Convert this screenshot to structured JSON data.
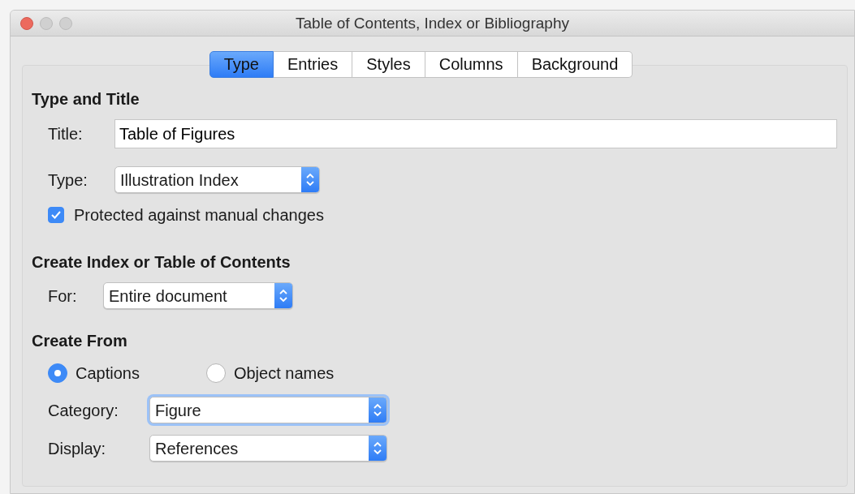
{
  "window": {
    "title": "Table of Contents, Index or Bibliography"
  },
  "tabs": [
    {
      "label": "Type",
      "selected": true
    },
    {
      "label": "Entries",
      "selected": false
    },
    {
      "label": "Styles",
      "selected": false
    },
    {
      "label": "Columns",
      "selected": false
    },
    {
      "label": "Background",
      "selected": false
    }
  ],
  "sections": [
    {
      "heading": "Type and Title",
      "rows": [
        {
          "kind": "text",
          "label": "Title:",
          "value": "Table of Figures"
        },
        {
          "kind": "select",
          "label": "Type:",
          "value": "Illustration Index",
          "focused": false
        },
        {
          "kind": "checkbox",
          "label": "Protected against manual changes",
          "checked": true
        }
      ]
    },
    {
      "heading": "Create Index or Table of Contents",
      "rows": [
        {
          "kind": "select",
          "label": "For:",
          "value": "Entire document",
          "focused": false
        }
      ]
    },
    {
      "heading": "Create From",
      "rows": [
        {
          "kind": "radios",
          "options": [
            {
              "label": "Captions",
              "selected": true
            },
            {
              "label": "Object names",
              "selected": false
            }
          ]
        },
        {
          "kind": "select",
          "label": "Category:",
          "value": "Figure",
          "focused": true
        },
        {
          "kind": "select",
          "label": "Display:",
          "value": "References",
          "focused": false
        }
      ]
    }
  ]
}
